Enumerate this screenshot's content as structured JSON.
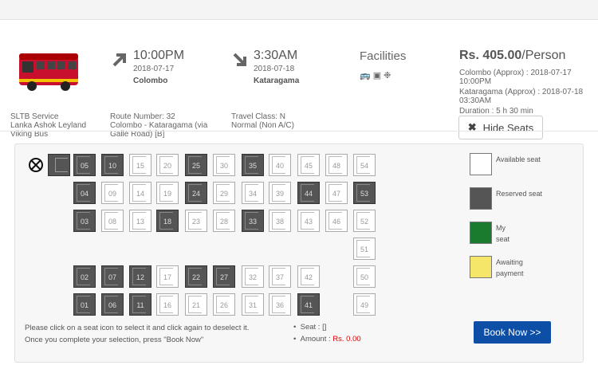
{
  "service": {
    "operator": "SLTB Service",
    "bus_model": "Lanka Ashok Leyland Viking Bus",
    "route_number": "Route Number: 32",
    "route": "Colombo - Kataragama (via Galle Road) [B]",
    "travel_class": "Travel Class: N",
    "travel_class_desc": "Normal (Non A/C)"
  },
  "departure": {
    "time": "10:00PM",
    "date": "2018-07-17",
    "city": "Colombo"
  },
  "arrival": {
    "time": "3:30AM",
    "date": "2018-07-18",
    "city": "Kataragama"
  },
  "facilities": {
    "title": "Facilities",
    "icons": [
      "bus-icon",
      "hotel-icon",
      "ticket-icon"
    ]
  },
  "pricing": {
    "price": "Rs. 405.00",
    "per": "/Person",
    "depart_line": "Colombo (Approx) : 2018-07-17 10:00PM",
    "arrive_line": "Kataragama (Approx) : 2018-07-18 03:30AM",
    "duration": "Duration : 5 h 30 min"
  },
  "hide_button": "Hide Seats",
  "seats": {
    "reserved": [
      "05",
      "10",
      "25",
      "35",
      "04",
      "24",
      "44",
      "53",
      "03",
      "18",
      "33",
      "01",
      "06",
      "11",
      "41",
      "02",
      "07",
      "12",
      "22",
      "27"
    ],
    "row1": [
      "05",
      "10",
      "15",
      "20",
      "25",
      "30",
      "35",
      "40",
      "45",
      "48",
      "54"
    ],
    "row2": [
      "04",
      "09",
      "14",
      "19",
      "24",
      "29",
      "34",
      "39",
      "44",
      "47",
      "53"
    ],
    "row3": [
      "03",
      "08",
      "13",
      "18",
      "23",
      "28",
      "33",
      "38",
      "43",
      "46",
      "52"
    ],
    "row4": [
      "51"
    ],
    "row5": [
      "02",
      "07",
      "12",
      "17",
      "22",
      "27",
      "32",
      "37",
      "42",
      "50"
    ],
    "row6": [
      "01",
      "06",
      "11",
      "16",
      "21",
      "26",
      "31",
      "36",
      "41",
      "49"
    ]
  },
  "legend": {
    "available": "Available seat",
    "reserved": "Reserved seat",
    "my": "My seat",
    "awaiting": "Awaiting payment",
    "colors": {
      "available": "#ffffff",
      "reserved": "#555555",
      "my": "#1a7a2e",
      "awaiting": "#f5e66a"
    }
  },
  "instructions": "Please click on a seat icon to select it and click again to deselect it. Once you complete your selection, press \"Book Now\"",
  "summary": {
    "seat_label": "Seat :",
    "seat_value": "[]",
    "amount_label": "Amount :",
    "amount_value": "Rs. 0.00"
  },
  "book_button": "Book Now >>"
}
